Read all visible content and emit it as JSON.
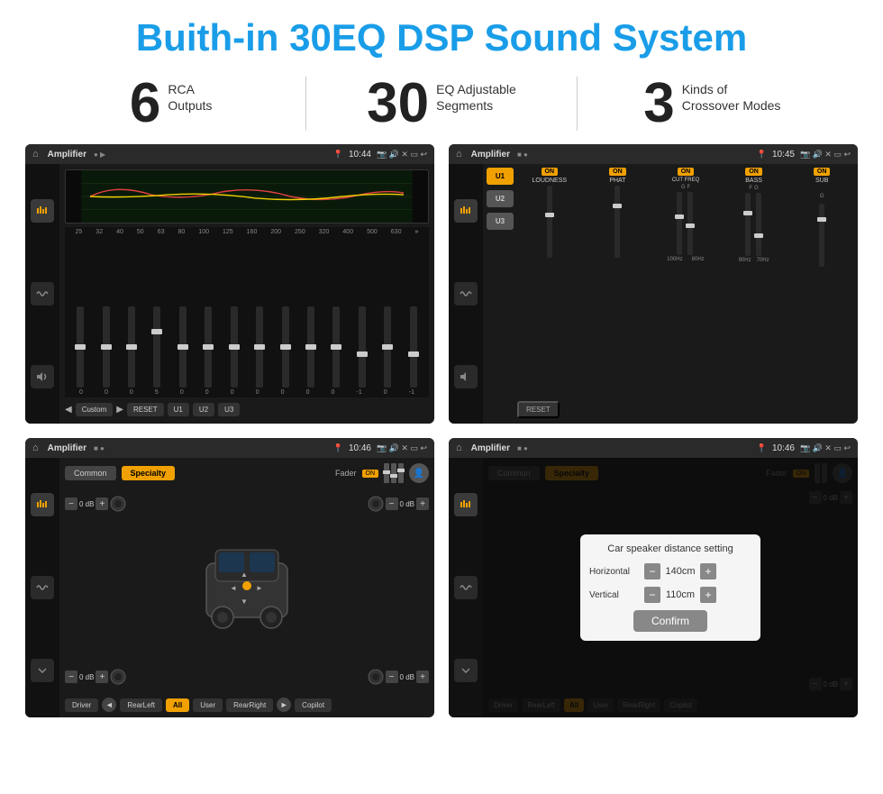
{
  "header": {
    "title": "Buith-in 30EQ DSP Sound System"
  },
  "stats": [
    {
      "number": "6",
      "label": "RCA\nOutputs"
    },
    {
      "number": "30",
      "label": "EQ Adjustable\nSegments"
    },
    {
      "number": "3",
      "label": "Kinds of\nCrossover Modes"
    }
  ],
  "screens": [
    {
      "id": "screen1",
      "status_bar": {
        "title": "Amplifier",
        "time": "10:44"
      },
      "eq_freqs": [
        "25",
        "32",
        "40",
        "50",
        "63",
        "80",
        "100",
        "125",
        "160",
        "200",
        "250",
        "320",
        "400",
        "500",
        "630"
      ],
      "eq_values": [
        "0",
        "0",
        "0",
        "5",
        "0",
        "0",
        "0",
        "0",
        "0",
        "0",
        "0",
        "-1",
        "0",
        "-1"
      ],
      "buttons": [
        "Custom",
        "RESET",
        "U1",
        "U2",
        "U3"
      ]
    },
    {
      "id": "screen2",
      "status_bar": {
        "title": "Amplifier",
        "time": "10:45"
      },
      "u_buttons": [
        "U1",
        "U2",
        "U3"
      ],
      "columns": [
        {
          "badge": "ON",
          "label": "LOUDNESS"
        },
        {
          "badge": "ON",
          "label": "PHAT"
        },
        {
          "badge": "ON",
          "label": "CUT FREQ"
        },
        {
          "badge": "ON",
          "label": "BASS"
        },
        {
          "badge": "ON",
          "label": "SUB"
        }
      ],
      "reset_label": "RESET"
    },
    {
      "id": "screen3",
      "status_bar": {
        "title": "Amplifier",
        "time": "10:46"
      },
      "tabs": [
        "Common",
        "Specialty"
      ],
      "fader_label": "Fader",
      "fader_on": "ON",
      "speaker_controls": {
        "top_left": "0 dB",
        "top_right": "0 dB",
        "bottom_left": "0 dB",
        "bottom_right": "0 dB"
      },
      "bottom_buttons": [
        "Driver",
        "RearLeft",
        "All",
        "User",
        "RearRight",
        "Copilot"
      ]
    },
    {
      "id": "screen4",
      "status_bar": {
        "title": "Amplifier",
        "time": "10:46"
      },
      "tabs": [
        "Common",
        "Specialty"
      ],
      "dialog": {
        "title": "Car speaker distance setting",
        "horizontal_label": "Horizontal",
        "horizontal_value": "140cm",
        "vertical_label": "Vertical",
        "vertical_value": "110cm",
        "confirm_label": "Confirm"
      },
      "speaker_controls": {
        "top_right": "0 dB",
        "bottom_right": "0 dB"
      },
      "bottom_buttons": [
        "Driver",
        "RearLeft",
        "All",
        "User",
        "RearRight",
        "Copilot"
      ]
    }
  ],
  "colors": {
    "accent": "#1a9de8",
    "gold": "#f0a000",
    "dark_bg": "#1a1a1a",
    "sidebar_bg": "#111111"
  }
}
